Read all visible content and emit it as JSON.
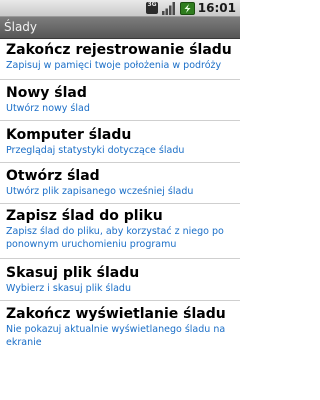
{
  "status_bar": {
    "network_label": "3G",
    "time": "16:01",
    "icons": [
      "network-3g-icon",
      "signal-bars-icon",
      "battery-charging-icon"
    ]
  },
  "title_bar": {
    "title": "Ślady"
  },
  "menu": {
    "items": [
      {
        "title": "Zakończ rejestrowanie śladu",
        "description": "Zapisuj w pamięci twoje położenia w podróży"
      },
      {
        "title": "Nowy ślad",
        "description": "Utwórz nowy ślad"
      },
      {
        "title": "Komputer śladu",
        "description": "Przeglądaj statystyki dotyczące śladu"
      },
      {
        "title": "Otwórz ślad",
        "description": "Utwórz plik zapisanego wcześniej śladu"
      },
      {
        "title": "Zapisz ślad do pliku",
        "description": "Zapisz ślad do pliku, aby korzystać z niego po ponownym uruchomieniu programu"
      },
      {
        "title": "Skasuj plik śladu",
        "description": "Wybierz i skasuj plik śladu"
      },
      {
        "title": "Zakończ wyświetlanie śladu",
        "description": "Nie pokazuj aktualnie wyświetlanego śladu na ekranie"
      }
    ]
  },
  "colors": {
    "item_title": "#000000",
    "item_description": "#1a6ec7",
    "title_bar": "#6a6a6a",
    "divider": "#cfcfcf"
  }
}
